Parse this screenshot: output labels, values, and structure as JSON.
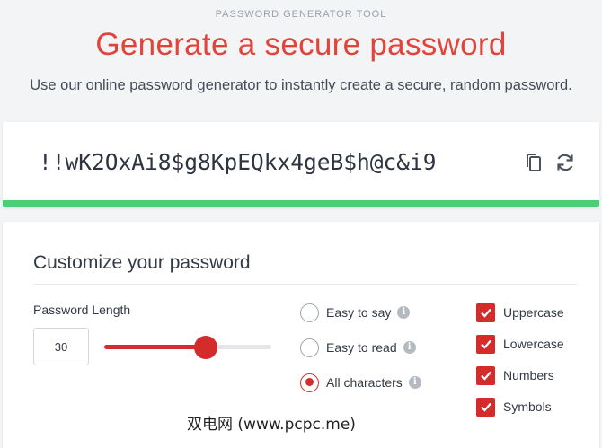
{
  "header": {
    "eyebrow": "PASSWORD GENERATOR TOOL",
    "title": "Generate a secure password",
    "subtitle": "Use our online password generator to instantly create a secure, random password."
  },
  "password": {
    "value": "!!wK2OxAi8$g8KpEQkx4geB$h@c&i9",
    "strength_color": "#4ccf72",
    "actions": [
      "copy-icon",
      "refresh-icon"
    ]
  },
  "customize": {
    "title": "Customize your password",
    "length_label": "Password Length",
    "length_value": "30",
    "slider_fraction": 0.61,
    "accent_color": "#d42b2b",
    "radio_options": [
      {
        "label": "Easy to say",
        "checked": false
      },
      {
        "label": "Easy to read",
        "checked": false
      },
      {
        "label": "All characters",
        "checked": true
      }
    ],
    "checkboxes": [
      {
        "label": "Uppercase",
        "checked": true
      },
      {
        "label": "Lowercase",
        "checked": true
      },
      {
        "label": "Numbers",
        "checked": true
      },
      {
        "label": "Symbols",
        "checked": true
      }
    ]
  },
  "watermark": "双电网 (www.pcpc.me)"
}
